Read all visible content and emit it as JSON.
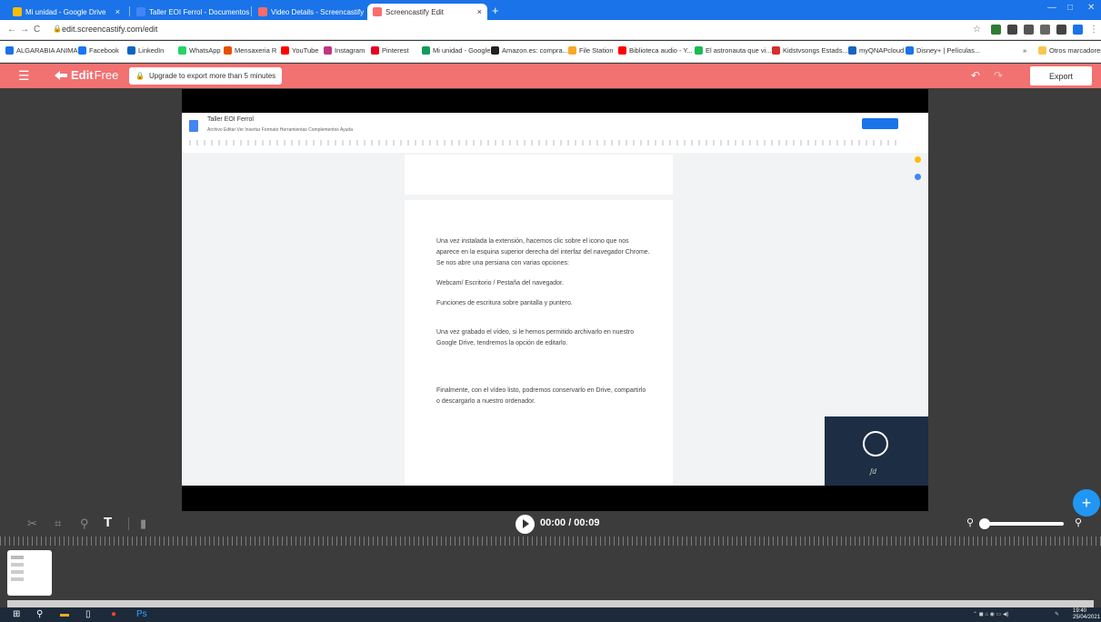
{
  "browser": {
    "tabs": [
      {
        "title": "Mi unidad - Google Drive",
        "color": "#fbbc04"
      },
      {
        "title": "Taller EOI Ferrol - Documentos d",
        "color": "#4285f4"
      },
      {
        "title": "Video Details - Screencastify",
        "color": "#ff6b6b"
      },
      {
        "title": "Screencastify Edit",
        "color": "#ff6b6b"
      }
    ],
    "url": "edit.screencastify.com/edit",
    "bookmarks": [
      {
        "label": "ALGARABIA ANIMA...",
        "color": "#1a73e8"
      },
      {
        "label": "Facebook",
        "color": "#1877f2"
      },
      {
        "label": "LinkedIn",
        "color": "#0a66c2"
      },
      {
        "label": "WhatsApp",
        "color": "#25d366"
      },
      {
        "label": "Mensaxeria R",
        "color": "#e65100"
      },
      {
        "label": "YouTube",
        "color": "#ff0000"
      },
      {
        "label": "Instagram",
        "color": "#c13584"
      },
      {
        "label": "Pinterest",
        "color": "#e60023"
      },
      {
        "label": "Mi unidad - Google...",
        "color": "#0f9d58"
      },
      {
        "label": "Amazon.es: compra...",
        "color": "#222222"
      },
      {
        "label": "File Station",
        "color": "#f9a825"
      },
      {
        "label": "Biblioteca audio - Y...",
        "color": "#ff0000"
      },
      {
        "label": "El astronauta que vi...",
        "color": "#1db954"
      },
      {
        "label": "Kidstvsongs Estads...",
        "color": "#d32f2f"
      },
      {
        "label": "myQNAPcloud",
        "color": "#1565c0"
      },
      {
        "label": "Disney+ | Películas...",
        "color": "#1a73e8"
      }
    ],
    "other_bookmarks": "Otros marcadores"
  },
  "app": {
    "logo_bold": "Edit",
    "logo_light": "Free",
    "upgrade_label": "Upgrade to export more than 5 minutes",
    "export_label": "Export",
    "accent": "#f27171"
  },
  "video_frame": {
    "doc_title": "Taller EOI Ferrol",
    "menus": "Archivo  Editar  Ver  Insertar  Formato  Herramientas  Complementos  Ayuda",
    "paragraphs": [
      "Una vez instalada la extensión, hacemos clic sobre el icono que nos aparece en la esquina superior derecha del interfaz del navegador Chrome. Se nos abre una persiana con varias opciones:",
      "Webcam/ Escritorio / Pestaña del navegador.",
      "Funciones de escritura sobre pantalla y puntero.",
      "Una vez grabado el vídeo, si le hemos permitido archivarlo en nuestro Google Drive, tendremos la opción de editarlo.",
      "Finalmente, con el vídeo listo, podremos conservarlo en Drive, compartirlo o descargarlo a nuestro ordenador."
    ]
  },
  "player": {
    "time": "00:00 / 00:09",
    "zoom_fraction": 0.05
  },
  "taskbar": {
    "time": "19:40",
    "date": "25/04/2021"
  }
}
